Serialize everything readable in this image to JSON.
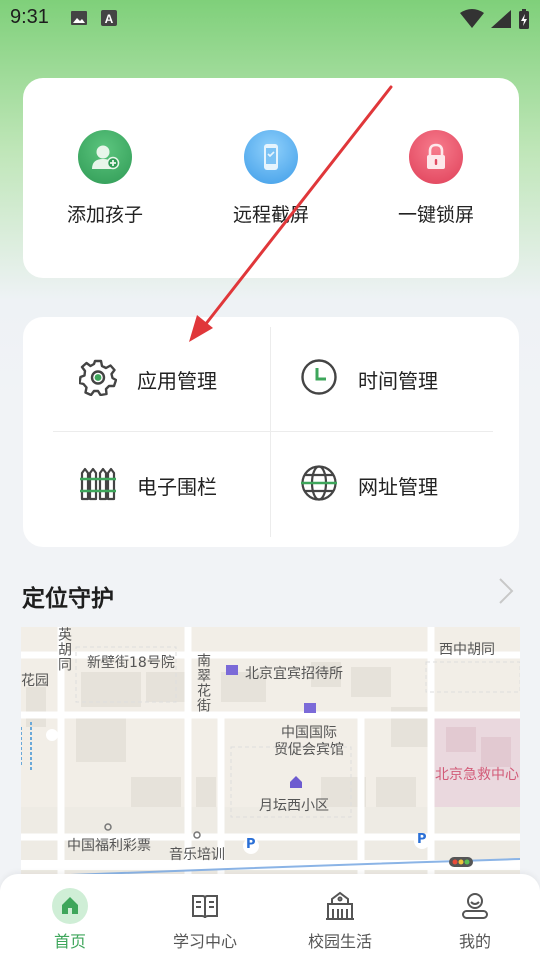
{
  "status_bar": {
    "time": "9:31",
    "icons": [
      "image-icon",
      "font-app-icon",
      "wifi-icon",
      "signal-icon",
      "battery-charging-icon"
    ]
  },
  "quick_actions": [
    {
      "label": "添加孩子",
      "icon": "add-child-icon",
      "color": "#3daa63"
    },
    {
      "label": "远程截屏",
      "icon": "phone-screenshot-icon",
      "color": "#4fa9f0"
    },
    {
      "label": "一键锁屏",
      "icon": "lock-icon",
      "color": "#e84b62"
    }
  ],
  "management": [
    {
      "label": "应用管理",
      "icon": "gear-icon"
    },
    {
      "label": "时间管理",
      "icon": "clock-icon"
    },
    {
      "label": "电子围栏",
      "icon": "fence-icon"
    },
    {
      "label": "网址管理",
      "icon": "globe-icon"
    }
  ],
  "location_section": {
    "title": "定位守护"
  },
  "map": {
    "labels": {
      "l1": "英胡同",
      "l2": "新壁街18号院",
      "l3": "南翠花街",
      "l4": "北京宜宾招待所",
      "l5": "西中胡同",
      "l6": "花园",
      "l7": "中国国际",
      "l8": "贸促会宾馆",
      "l9": "北京急救中心",
      "l10": "月坛西小区",
      "l11": "中国福利彩票",
      "l12": "音乐培训",
      "p1": "P",
      "p2": "P"
    }
  },
  "bottom_nav": [
    {
      "label": "首页",
      "icon": "home-icon",
      "active": true
    },
    {
      "label": "学习中心",
      "icon": "book-icon",
      "active": false
    },
    {
      "label": "校园生活",
      "icon": "school-icon",
      "active": false
    },
    {
      "label": "我的",
      "icon": "profile-icon",
      "active": false
    }
  ],
  "colors": {
    "accent": "#3ea65b",
    "annotation_arrow": "#e0373a"
  }
}
